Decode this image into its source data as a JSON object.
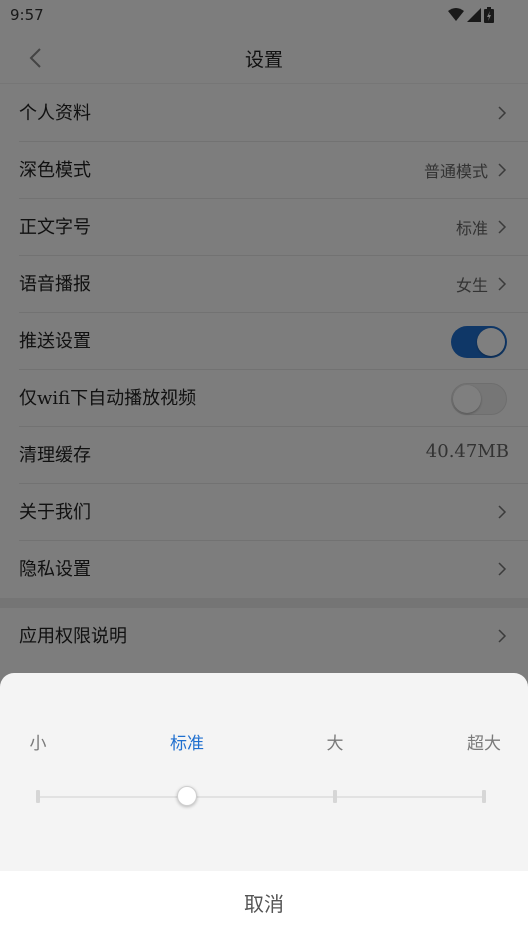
{
  "status_bar": {
    "time": "9:57"
  },
  "nav": {
    "title": "设置"
  },
  "settings": {
    "profile": {
      "label": "个人资料"
    },
    "dark_mode": {
      "label": "深色模式",
      "value": "普通模式"
    },
    "font_size": {
      "label": "正文字号",
      "value": "标准"
    },
    "voice": {
      "label": "语音播报",
      "value": "女生"
    },
    "push": {
      "label": "推送设置",
      "enabled": true
    },
    "wifi_autoplay": {
      "label": "仅wifi下自动播放视频",
      "enabled": false
    },
    "cache": {
      "label": "清理缓存",
      "value": "40.47MB"
    },
    "about": {
      "label": "关于我们"
    },
    "privacy": {
      "label": "隐私设置"
    },
    "permissions": {
      "label": "应用权限说明"
    }
  },
  "font_sheet": {
    "options": [
      "小",
      "标准",
      "大",
      "超大"
    ],
    "selected_index": 1,
    "cancel_label": "取消"
  },
  "colors": {
    "accent": "#1f6fcf",
    "overlay": "rgba(0,0,0,0.5)"
  }
}
